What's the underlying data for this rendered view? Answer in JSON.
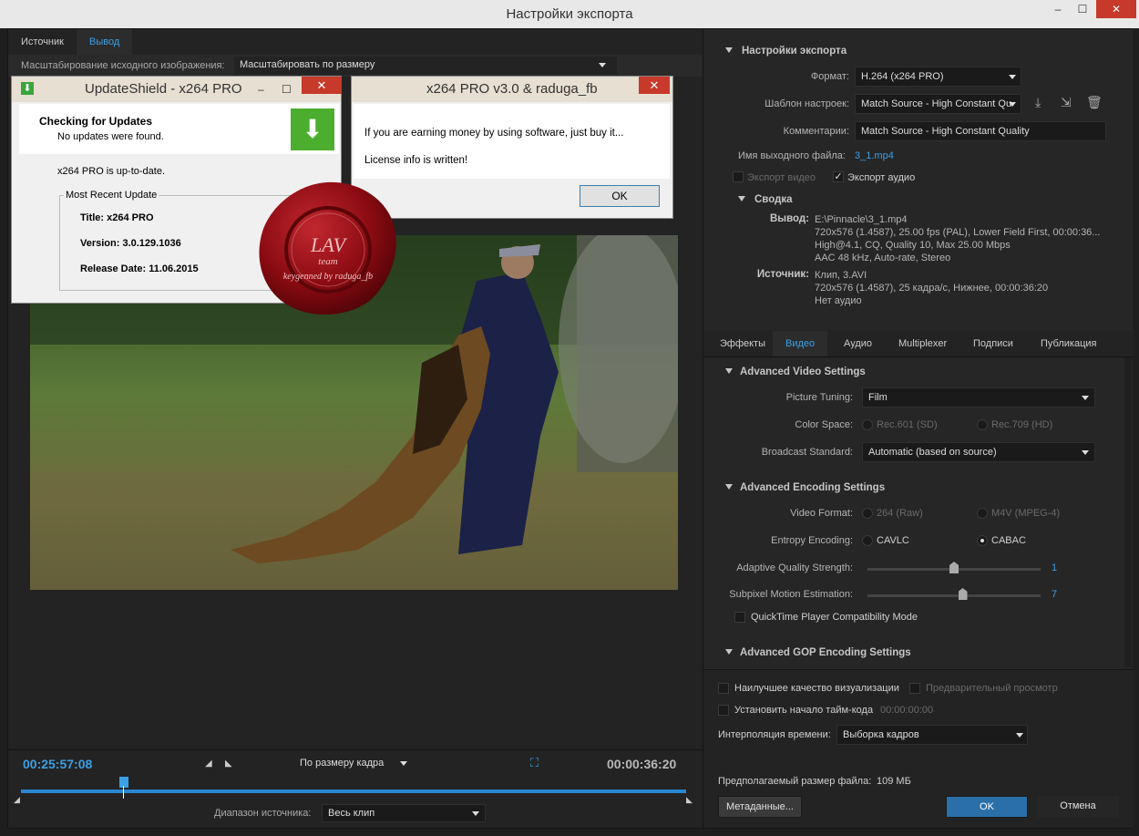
{
  "window": {
    "title": "Настройки экспорта",
    "min": "–",
    "max": "☐",
    "close": "✕"
  },
  "left": {
    "tabs": [
      "Источник",
      "Вывод"
    ],
    "scale_label": "Масштабирование исходного изображения:",
    "scale_value": "Масштабировать по размеру",
    "timecode_left": "00:25:57:08",
    "timecode_right": "00:00:36:20",
    "fit_value": "По размеру кадра",
    "range_label": "Диапазон источника:",
    "range_value": "Весь клип"
  },
  "update_dialog": {
    "title": "UpdateShield - x264 PRO",
    "heading": "Checking for Updates",
    "no_updates": "No updates were found.",
    "up_to_date": "x264 PRO is up-to-date.",
    "group_title": "Most Recent Update",
    "title_line": "Title: x264 PRO",
    "version_line": "Version: 3.0.129.1036",
    "release_line": "Release Date: 11.06.2015"
  },
  "license_dialog": {
    "title": "x264 PRO v3.0 & raduga_fb",
    "line1": "If you are earning money by using software, just buy it...",
    "line2": "License info is written!",
    "ok": "OK"
  },
  "seal": {
    "top_text": "LAV",
    "sub_text": "team",
    "bottom_text": "keygenned by raduga_fb",
    "color": "#8b0b12"
  },
  "export": {
    "section_title": "Настройки экспорта",
    "format_label": "Формат:",
    "format_value": "H.264 (x264 PRO)",
    "preset_label": "Шаблон настроек:",
    "preset_value": "Match Source - High Constant Qu",
    "comment_label": "Комментарии:",
    "comment_value": "Match Source - High Constant Quality",
    "output_name_label": "Имя выходного файла:",
    "output_name_value": "3_1.mp4",
    "export_video": "Экспорт видео",
    "export_audio": "Экспорт аудио",
    "summary_title": "Сводка",
    "output_label": "Вывод:",
    "output_lines": [
      "E:\\Pinnacle\\3_1.mp4",
      "720x576 (1.4587), 25.00 fps (PAL), Lower Field First, 00:00:36...",
      "High@4.1, CQ, Quality 10, Max 25.00 Mbps",
      "AAC 48 kHz, Auto-rate, Stereo"
    ],
    "source_label": "Источник:",
    "source_lines": [
      "Клип, 3.AVI",
      "720x576 (1.4587), 25 кадра/с, Нижнее, 00:00:36:20",
      "Нет аудио"
    ]
  },
  "tabs2": [
    "Эффекты",
    "Видео",
    "Аудио",
    "Multiplexer",
    "Подписи",
    "Публикация"
  ],
  "video": {
    "adv_video_title": "Advanced Video Settings",
    "picture_tuning_label": "Picture Tuning:",
    "picture_tuning_value": "Film",
    "color_space_label": "Color Space:",
    "color_space_opt1": "Rec.601 (SD)",
    "color_space_opt2": "Rec.709 (HD)",
    "broadcast_label": "Broadcast Standard:",
    "broadcast_value": "Automatic (based on source)",
    "adv_enc_title": "Advanced Encoding Settings",
    "video_format_label": "Video Format:",
    "video_format_opt1": "264 (Raw)",
    "video_format_opt2": "M4V (MPEG-4)",
    "entropy_label": "Entropy Encoding:",
    "entropy_opt1": "CAVLC",
    "entropy_opt2": "CABAC",
    "aq_label": "Adaptive Quality Strength:",
    "aq_value": "1",
    "aq_fraction": 0.5,
    "subpixel_label": "Subpixel Motion Estimation:",
    "subpixel_value": "7",
    "subpixel_fraction": 0.55,
    "quicktime_label": "QuickTime Player Compatibility Mode",
    "adv_gop_title": "Advanced GOP Encoding Settings"
  },
  "bottom": {
    "best_quality": "Наилучшее качество визуализации",
    "preview": "Предварительный просмотр",
    "set_tc": "Установить начало тайм-кода",
    "tc_value": "00:00:00:00",
    "interp_label": "Интерполяция времени:",
    "interp_value": "Выборка кадров",
    "size_label": "Предполагаемый размер файла:",
    "size_value": "109 МБ",
    "metadata": "Метаданные...",
    "ok": "OK",
    "cancel": "Отмена"
  },
  "colors": {
    "accent": "#3aa0e6",
    "ok_button": "#2a6fa8",
    "bg": "#232323"
  }
}
